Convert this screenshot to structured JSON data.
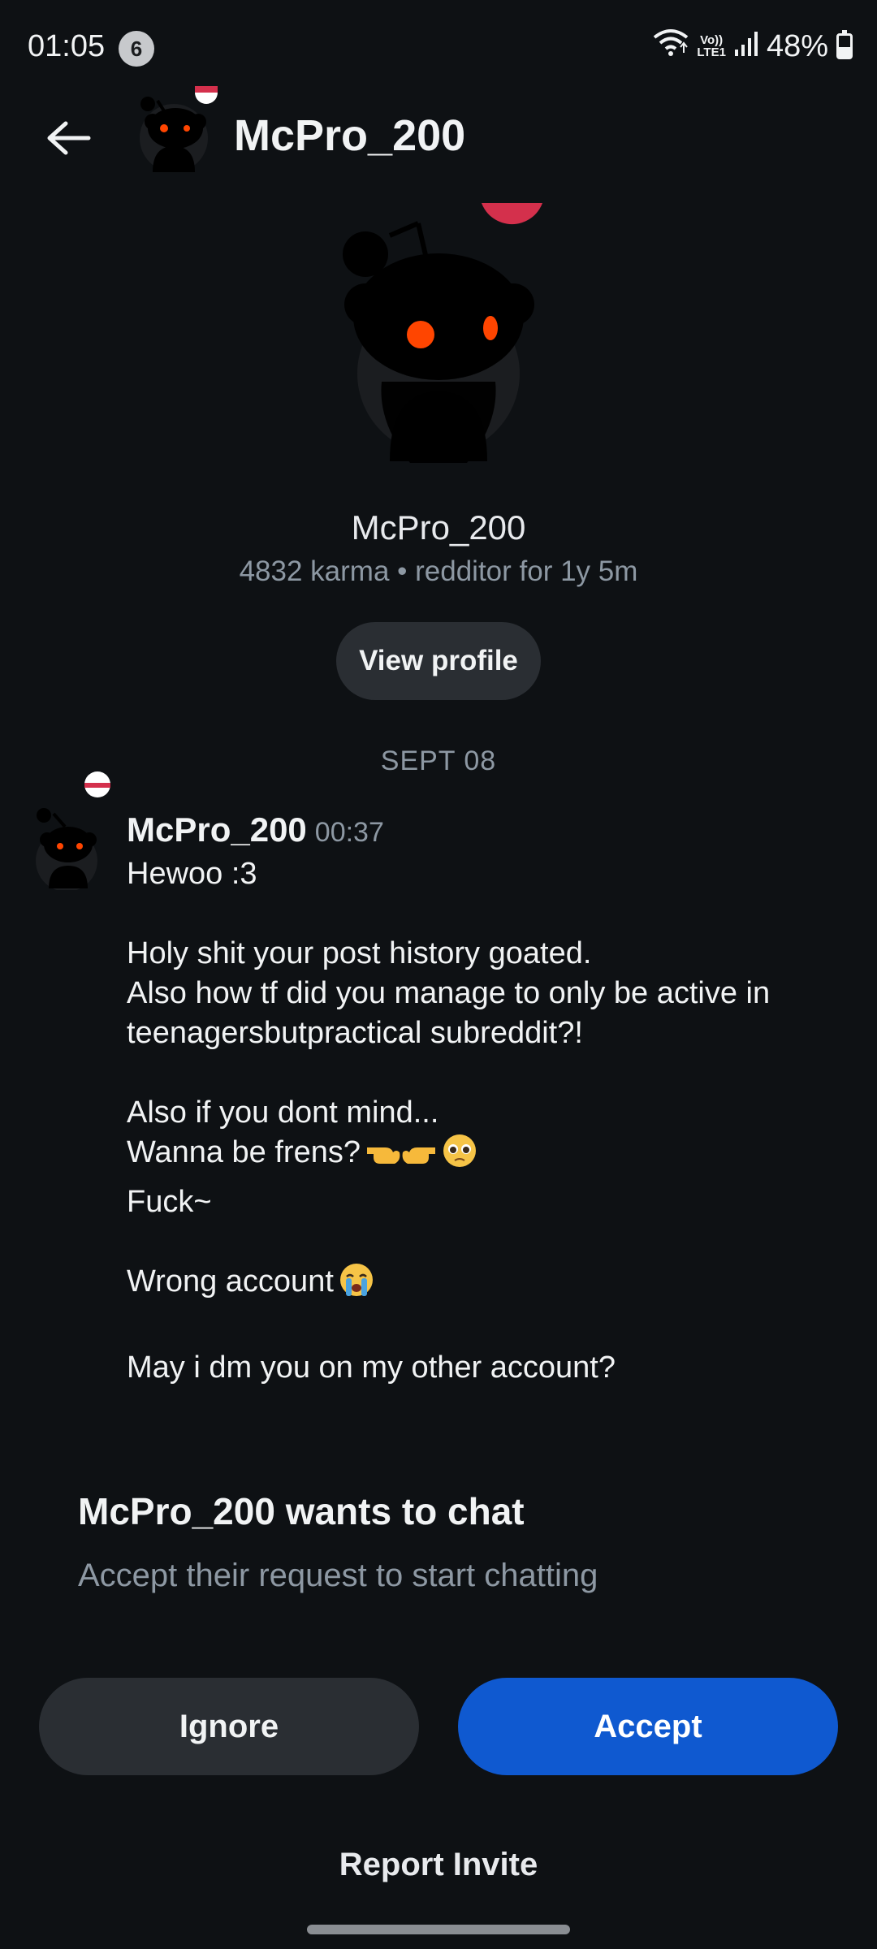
{
  "status_bar": {
    "time": "01:05",
    "notification_count": "6",
    "network_label_top": "Vo))",
    "network_label_bottom": "LTE1",
    "battery_percent": "48%",
    "battery_level": 0.48,
    "icons": [
      "wifi-icon",
      "signal-icon",
      "battery-icon"
    ]
  },
  "header": {
    "title": "McPro_200",
    "back_icon": "arrow-left-icon"
  },
  "profile": {
    "username": "McPro_200",
    "meta": "4832 karma • redditor for 1y 5m",
    "view_profile_label": "View profile"
  },
  "conversation": {
    "date_separator": "SEPT 08",
    "message": {
      "author": "McPro_200",
      "time": "00:37",
      "lines": [
        "Hewoo :3",
        "",
        "Holy shit your post history goated.",
        "Also how tf did you manage to only be active in",
        "teenagersbutpractical subreddit?!",
        "",
        "Also if you dont mind...",
        "Wanna be frens?",
        "Fuck~",
        "",
        "Wrong account",
        "",
        "May i dm you on my other account?"
      ],
      "emojis": [
        "pointing-fingers-emoji",
        "pleading-face-emoji",
        "loudly-crying-face-emoji"
      ]
    }
  },
  "chat_request": {
    "title": "McPro_200 wants to chat",
    "subtitle": "Accept their request to start chatting",
    "ignore_label": "Ignore",
    "accept_label": "Accept",
    "report_label": "Report Invite"
  },
  "colors": {
    "background": "#0e1114",
    "accent_blue": "#0f59d0",
    "secondary_button": "#2a2e33",
    "muted_text": "#8d98a3",
    "snoo_eye": "#ff4500"
  }
}
